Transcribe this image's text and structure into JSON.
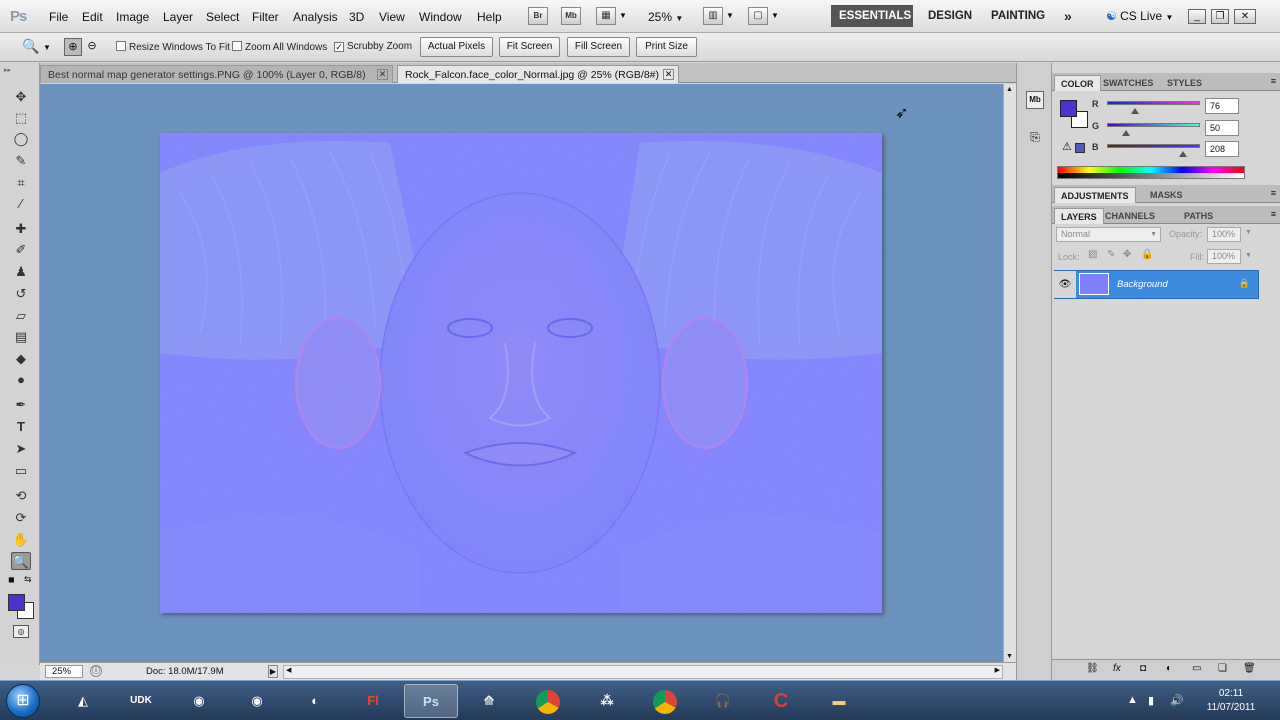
{
  "app": {
    "logo": "Ps"
  },
  "menu": [
    "File",
    "Edit",
    "Image",
    "Layer",
    "Select",
    "Filter",
    "Analysis",
    "3D",
    "View",
    "Window",
    "Help"
  ],
  "menubar": {
    "bridge_label": "Br",
    "minibridge_label": "Mb",
    "zoom_value": "25%",
    "workspaces": [
      "ESSENTIALS",
      "DESIGN",
      "PAINTING"
    ],
    "overflow_label": "»",
    "cs_live": "CS Live"
  },
  "options": {
    "checks": [
      {
        "label": "Resize Windows To Fit",
        "checked": false
      },
      {
        "label": "Zoom All Windows",
        "checked": false
      },
      {
        "label": "Scrubby Zoom",
        "checked": true
      }
    ],
    "buttons": [
      "Actual Pixels",
      "Fit Screen",
      "Fill Screen",
      "Print Size"
    ]
  },
  "tabs": [
    {
      "label": "Best normal map generator settings.PNG @ 100% (Layer 0, RGB/8)",
      "active": false
    },
    {
      "label": "Rock_Falcon.face_color_Normal.jpg @ 25% (RGB/8#)",
      "active": true
    }
  ],
  "status": {
    "zoom": "25%",
    "doc": "Doc: 18.0M/17.9M"
  },
  "color_panel": {
    "tabs": [
      "COLOR",
      "SWATCHES",
      "STYLES"
    ],
    "foreground": "#4c32d0",
    "channels": [
      {
        "label": "R",
        "value": "76",
        "level": 0.298
      },
      {
        "label": "G",
        "value": "50",
        "level": 0.196
      },
      {
        "label": "B",
        "value": "208",
        "level": 0.816
      }
    ]
  },
  "adjustments_panel": {
    "tabs": [
      "ADJUSTMENTS",
      "MASKS"
    ]
  },
  "layers_panel": {
    "tabs": [
      "LAYERS",
      "CHANNELS",
      "PATHS"
    ],
    "blend_mode": "Normal",
    "opacity_label": "Opacity:",
    "opacity": "100%",
    "lock_label": "Lock:",
    "fill_label": "Fill:",
    "fill": "100%",
    "layers": [
      {
        "name": "Background",
        "selected": true,
        "locked": true
      }
    ]
  },
  "taskbar": {
    "apps": [
      "Unity",
      "UDK",
      "GMax",
      "Spline",
      "Terragen",
      "Flash",
      "Photoshop",
      "Topogun",
      "Chrome",
      "BlackBerry",
      "Chrome Dev",
      "Audacity",
      "CCleaner",
      "Explorer"
    ],
    "time": "02:11",
    "date": "11/07/2011"
  }
}
